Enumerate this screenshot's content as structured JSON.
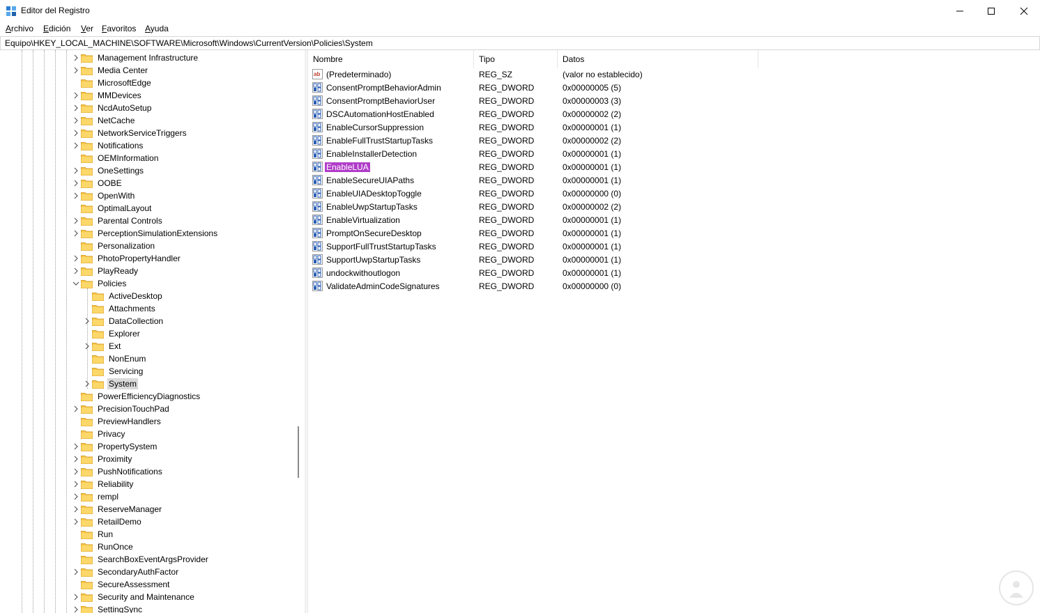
{
  "window": {
    "title": "Editor del Registro"
  },
  "menu": [
    {
      "label": "Archivo",
      "u": "A",
      "rest": "rchivo"
    },
    {
      "label": "Edición",
      "u": "E",
      "rest": "dición"
    },
    {
      "label": "Ver",
      "u": "V",
      "rest": "er"
    },
    {
      "label": "Favoritos",
      "u": "F",
      "rest": "avoritos"
    },
    {
      "label": "Ayuda",
      "u": "A",
      "rest": "yuda"
    }
  ],
  "address": {
    "path": "Equipo\\HKEY_LOCAL_MACHINE\\SOFTWARE\\Microsoft\\Windows\\CurrentVersion\\Policies\\System"
  },
  "tree": [
    {
      "label": "Management Infrastructure",
      "level": 0,
      "chevron": "right"
    },
    {
      "label": "Media Center",
      "level": 0,
      "chevron": "right"
    },
    {
      "label": "MicrosoftEdge",
      "level": 0,
      "chevron": "none"
    },
    {
      "label": "MMDevices",
      "level": 0,
      "chevron": "right"
    },
    {
      "label": "NcdAutoSetup",
      "level": 0,
      "chevron": "right"
    },
    {
      "label": "NetCache",
      "level": 0,
      "chevron": "right"
    },
    {
      "label": "NetworkServiceTriggers",
      "level": 0,
      "chevron": "right"
    },
    {
      "label": "Notifications",
      "level": 0,
      "chevron": "right"
    },
    {
      "label": "OEMInformation",
      "level": 0,
      "chevron": "none"
    },
    {
      "label": "OneSettings",
      "level": 0,
      "chevron": "right"
    },
    {
      "label": "OOBE",
      "level": 0,
      "chevron": "right"
    },
    {
      "label": "OpenWith",
      "level": 0,
      "chevron": "right"
    },
    {
      "label": "OptimalLayout",
      "level": 0,
      "chevron": "none"
    },
    {
      "label": "Parental Controls",
      "level": 0,
      "chevron": "right"
    },
    {
      "label": "PerceptionSimulationExtensions",
      "level": 0,
      "chevron": "right"
    },
    {
      "label": "Personalization",
      "level": 0,
      "chevron": "none"
    },
    {
      "label": "PhotoPropertyHandler",
      "level": 0,
      "chevron": "right"
    },
    {
      "label": "PlayReady",
      "level": 0,
      "chevron": "right"
    },
    {
      "label": "Policies",
      "level": 0,
      "chevron": "down"
    },
    {
      "label": "ActiveDesktop",
      "level": 1,
      "chevron": "none"
    },
    {
      "label": "Attachments",
      "level": 1,
      "chevron": "none"
    },
    {
      "label": "DataCollection",
      "level": 1,
      "chevron": "right"
    },
    {
      "label": "Explorer",
      "level": 1,
      "chevron": "none"
    },
    {
      "label": "Ext",
      "level": 1,
      "chevron": "right"
    },
    {
      "label": "NonEnum",
      "level": 1,
      "chevron": "none"
    },
    {
      "label": "Servicing",
      "level": 1,
      "chevron": "none"
    },
    {
      "label": "System",
      "level": 1,
      "chevron": "right",
      "selected": true
    },
    {
      "label": "PowerEfficiencyDiagnostics",
      "level": 0,
      "chevron": "none"
    },
    {
      "label": "PrecisionTouchPad",
      "level": 0,
      "chevron": "right"
    },
    {
      "label": "PreviewHandlers",
      "level": 0,
      "chevron": "none"
    },
    {
      "label": "Privacy",
      "level": 0,
      "chevron": "none"
    },
    {
      "label": "PropertySystem",
      "level": 0,
      "chevron": "right"
    },
    {
      "label": "Proximity",
      "level": 0,
      "chevron": "right"
    },
    {
      "label": "PushNotifications",
      "level": 0,
      "chevron": "right"
    },
    {
      "label": "Reliability",
      "level": 0,
      "chevron": "right"
    },
    {
      "label": "rempl",
      "level": 0,
      "chevron": "right"
    },
    {
      "label": "ReserveManager",
      "level": 0,
      "chevron": "right"
    },
    {
      "label": "RetailDemo",
      "level": 0,
      "chevron": "right"
    },
    {
      "label": "Run",
      "level": 0,
      "chevron": "none"
    },
    {
      "label": "RunOnce",
      "level": 0,
      "chevron": "none"
    },
    {
      "label": "SearchBoxEventArgsProvider",
      "level": 0,
      "chevron": "none"
    },
    {
      "label": "SecondaryAuthFactor",
      "level": 0,
      "chevron": "right"
    },
    {
      "label": "SecureAssessment",
      "level": 0,
      "chevron": "none"
    },
    {
      "label": "Security and Maintenance",
      "level": 0,
      "chevron": "right"
    },
    {
      "label": "SettingSync",
      "level": 0,
      "chevron": "right"
    }
  ],
  "columns": {
    "name": "Nombre",
    "type": "Tipo",
    "data": "Datos"
  },
  "values": [
    {
      "name": "(Predeterminado)",
      "type": "REG_SZ",
      "data": "(valor no establecido)",
      "icon": "string-value-icon"
    },
    {
      "name": "ConsentPromptBehaviorAdmin",
      "type": "REG_DWORD",
      "data": "0x00000005 (5)",
      "icon": "dword-value-icon"
    },
    {
      "name": "ConsentPromptBehaviorUser",
      "type": "REG_DWORD",
      "data": "0x00000003 (3)",
      "icon": "dword-value-icon"
    },
    {
      "name": "DSCAutomationHostEnabled",
      "type": "REG_DWORD",
      "data": "0x00000002 (2)",
      "icon": "dword-value-icon"
    },
    {
      "name": "EnableCursorSuppression",
      "type": "REG_DWORD",
      "data": "0x00000001 (1)",
      "icon": "dword-value-icon"
    },
    {
      "name": "EnableFullTrustStartupTasks",
      "type": "REG_DWORD",
      "data": "0x00000002 (2)",
      "icon": "dword-value-icon"
    },
    {
      "name": "EnableInstallerDetection",
      "type": "REG_DWORD",
      "data": "0x00000001 (1)",
      "icon": "dword-value-icon"
    },
    {
      "name": "EnableLUA",
      "type": "REG_DWORD",
      "data": "0x00000001 (1)",
      "icon": "dword-value-icon",
      "highlight": true
    },
    {
      "name": "EnableSecureUIAPaths",
      "type": "REG_DWORD",
      "data": "0x00000001 (1)",
      "icon": "dword-value-icon"
    },
    {
      "name": "EnableUIADesktopToggle",
      "type": "REG_DWORD",
      "data": "0x00000000 (0)",
      "icon": "dword-value-icon"
    },
    {
      "name": "EnableUwpStartupTasks",
      "type": "REG_DWORD",
      "data": "0x00000002 (2)",
      "icon": "dword-value-icon"
    },
    {
      "name": "EnableVirtualization",
      "type": "REG_DWORD",
      "data": "0x00000001 (1)",
      "icon": "dword-value-icon"
    },
    {
      "name": "PromptOnSecureDesktop",
      "type": "REG_DWORD",
      "data": "0x00000001 (1)",
      "icon": "dword-value-icon"
    },
    {
      "name": "SupportFullTrustStartupTasks",
      "type": "REG_DWORD",
      "data": "0x00000001 (1)",
      "icon": "dword-value-icon"
    },
    {
      "name": "SupportUwpStartupTasks",
      "type": "REG_DWORD",
      "data": "0x00000001 (1)",
      "icon": "dword-value-icon"
    },
    {
      "name": "undockwithoutlogon",
      "type": "REG_DWORD",
      "data": "0x00000001 (1)",
      "icon": "dword-value-icon"
    },
    {
      "name": "ValidateAdminCodeSignatures",
      "type": "REG_DWORD",
      "data": "0x00000000 (0)",
      "icon": "dword-value-icon"
    }
  ],
  "colors": {
    "highlight": "#b03cc9",
    "selected_tree": "#d9d9d9",
    "folder": "#f8c84a",
    "icon_blue": "#2b5fb4",
    "watermark": "#d23c3c"
  }
}
